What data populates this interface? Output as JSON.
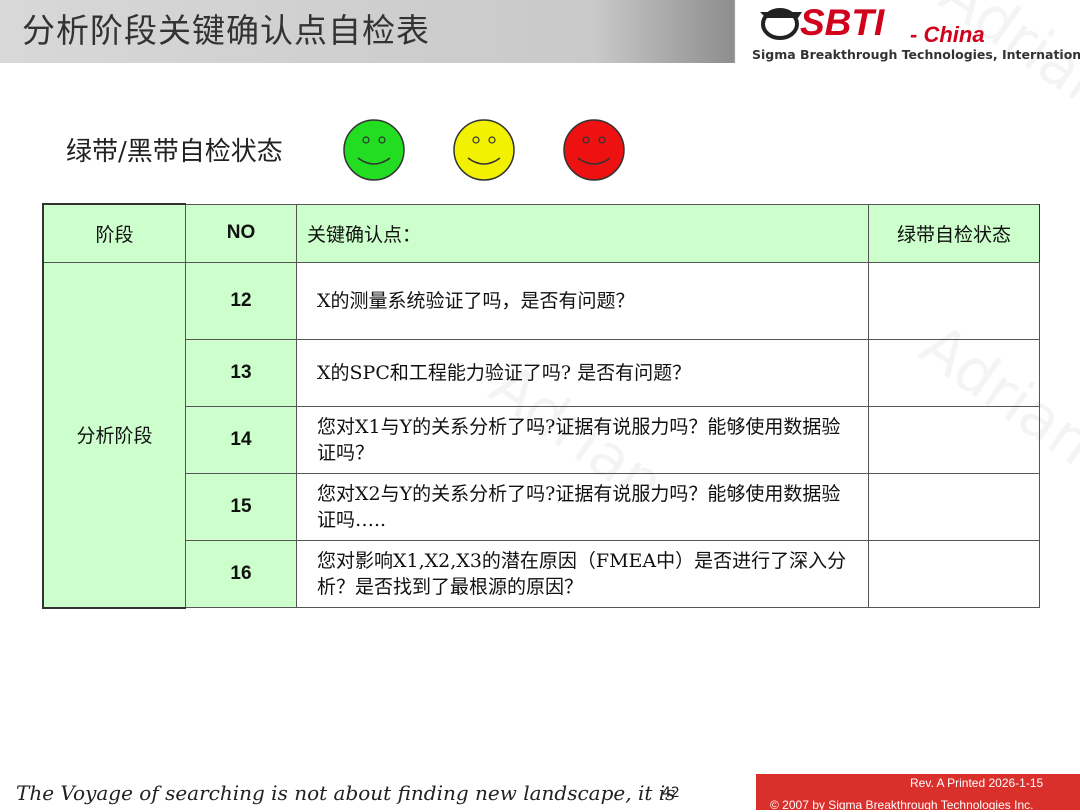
{
  "header": {
    "title": "分析阶段关键确认点自检表",
    "logo_word": "SBTI",
    "logo_china": "- China",
    "logo_subtitle": "Sigma Breakthrough Technologies, International"
  },
  "status_legend": {
    "label": "绿带/黑带自检状态",
    "faces": [
      {
        "color": "#22dd22",
        "meaning": "green"
      },
      {
        "color": "#f2f200",
        "meaning": "yellow"
      },
      {
        "color": "#ee1111",
        "meaning": "red"
      }
    ]
  },
  "table": {
    "headers": {
      "stage": "阶段",
      "no": "NO",
      "key_points": "关键确认点：",
      "status": "绿带自检状态"
    },
    "stage_name": "分析阶段",
    "rows": [
      {
        "no": "12",
        "text": "X的测量系统验证了吗，是否有问题？",
        "status": ""
      },
      {
        "no": "13",
        "text": "X的SPC和工程能力验证了吗? 是否有问题？",
        "status": ""
      },
      {
        "no": "14",
        "text": "您对X1与Y的关系分析了吗?证据有说服力吗？能够使用数据验证吗？",
        "status": ""
      },
      {
        "no": "15",
        "text": "您对X2与Y的关系分析了吗?证据有说服力吗？能够使用数据验证吗…..",
        "status": ""
      },
      {
        "no": "16",
        "text": "您对影响X1,X2,X3的潜在原因（FMEA中）是否进行了深入分析？是否找到了最根源的原因？",
        "status": ""
      }
    ]
  },
  "footer": {
    "quote": "The Voyage of searching is not about finding new landscape, it is",
    "page_number": "42",
    "rev": "Rev. A   Printed 2026-1-15",
    "copyright": "© 2007 by Sigma Breakthrough Technologies Inc."
  },
  "watermark_text": "Adrian"
}
